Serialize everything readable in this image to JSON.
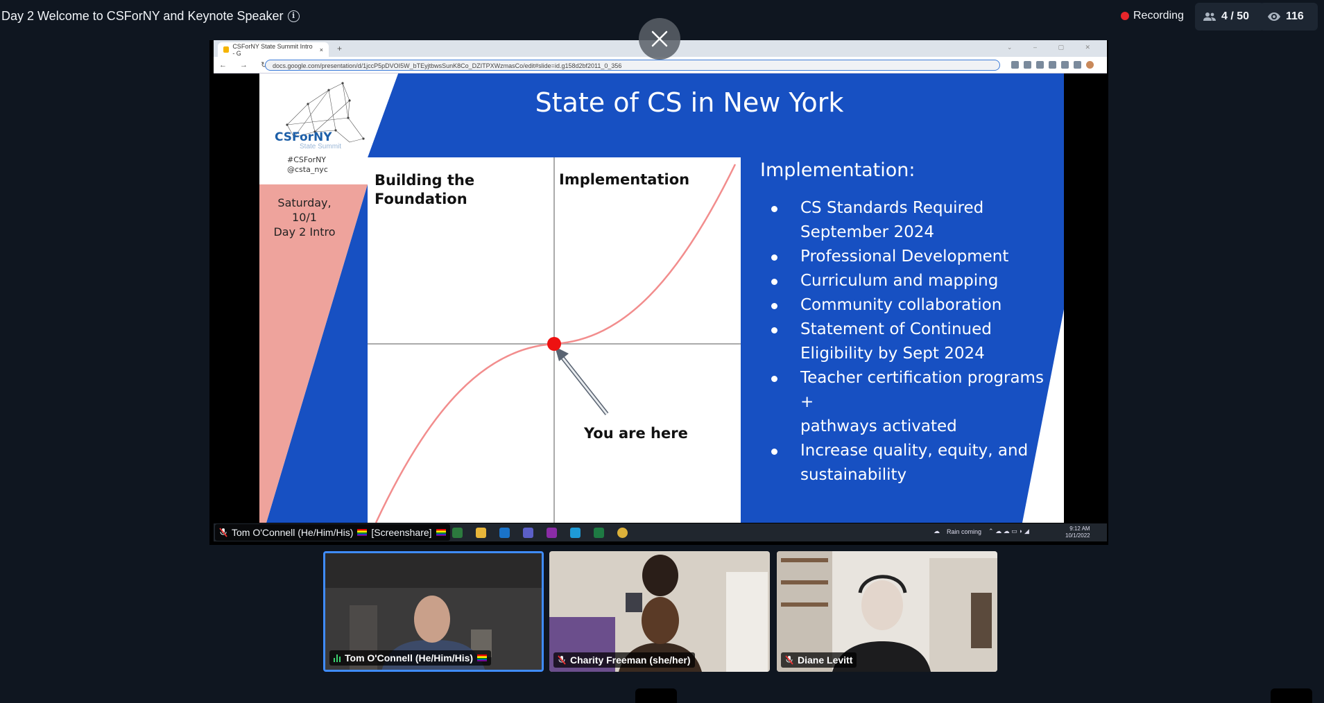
{
  "header": {
    "title": "Day 2 Welcome to CSForNY and Keynote Speaker",
    "recording_label": "Recording",
    "participants_count": "4 / 50",
    "viewers_count": "116"
  },
  "browser": {
    "tab_title": "CSForNY State Summit Intro - G",
    "url": "docs.google.com/presentation/d/1jccP5pDVOI5W_bTEyjtbwsSunK8Co_DZITPXWzmasCo/edit#slide=id.g158d2bf2011_0_356"
  },
  "slide": {
    "title": "State of CS in New York",
    "logo_text": "CSForNY",
    "logo_subtext": "State Summit",
    "hashtag": "#CSForNY",
    "handle": "@csta_nyc",
    "date_line1": "Saturday, 10/1",
    "date_line2": "Day 2 Intro",
    "graph_left_label_1": "Building the",
    "graph_left_label_2": "Foundation",
    "graph_right_label": "Implementation",
    "marker_label": "You are here",
    "implementation_heading": "Implementation:",
    "bullets": [
      {
        "line1": "CS Standards Required",
        "line2": "September 2024"
      },
      {
        "line1": "Professional Development",
        "line2": ""
      },
      {
        "line1": "Curriculum and mapping",
        "line2": ""
      },
      {
        "line1": "Community collaboration",
        "line2": ""
      },
      {
        "line1": "Statement of Continued",
        "line2": "Eligibility by Sept 2024"
      },
      {
        "line1": "Teacher certification programs +",
        "line2": "pathways activated"
      },
      {
        "line1": "Increase quality, equity, and",
        "line2": "sustainability"
      }
    ]
  },
  "taskbar": {
    "weather": "Rain coming",
    "time": "9:12 AM",
    "date": "10/1/2022"
  },
  "screenshare": {
    "presenter_label": "Tom O'Connell (He/Him/His)",
    "screenshare_suffix": "[Screenshare]"
  },
  "participants": [
    {
      "name": "Tom O'Connell (He/Him/His)",
      "speaking": true
    },
    {
      "name": "Charity Freeman (she/her)",
      "speaking": false
    },
    {
      "name": "Diane Levitt",
      "speaking": false
    }
  ],
  "colors": {
    "slide_blue": "#1750c2",
    "slide_pink": "#eea39c",
    "marker_red": "#ee1111",
    "active_border": "#3f8cff",
    "recording_red": "#e8262b"
  }
}
